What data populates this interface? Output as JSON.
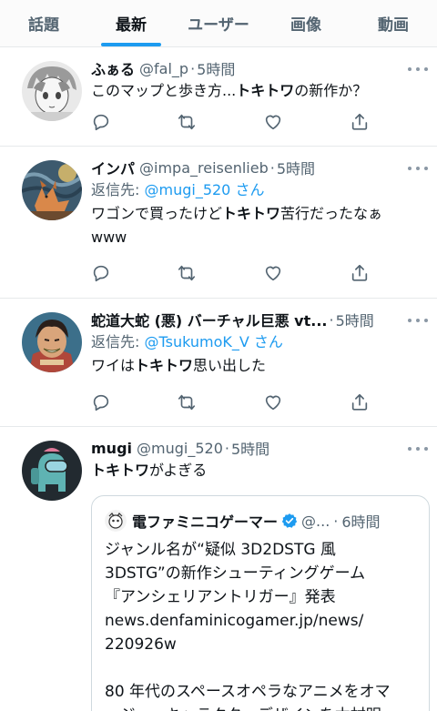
{
  "tabs": [
    "話題",
    "最新",
    "ユーザー",
    "画像",
    "動画"
  ],
  "tweets": [
    {
      "name": "ふぁる",
      "handle": "@fal_p",
      "dot": "·",
      "time": "5時間",
      "text_pre": "このマップと歩き方...",
      "text_bold": "トキトワ",
      "text_post": "の新作か？"
    },
    {
      "name": "インパ",
      "handle": "@impa_reisenlieb",
      "dot": "·",
      "time": "5時間",
      "reply_label": "返信先: ",
      "reply_mention": "@mugi_520 さん",
      "text_pre": "ワゴンで買ったけど",
      "text_bold": "トキトワ",
      "text_post": "苦行だったなぁ",
      "text_line2": "www"
    },
    {
      "name": "蛇道大蛇 (悪) バーチャル巨悪 vt...",
      "dot": "·",
      "time": "5時間",
      "reply_label": "返信先: ",
      "reply_mention": "@TsukumoK_V さん",
      "text_pre": "ワイは",
      "text_bold": "トキトワ",
      "text_post": "思い出した"
    },
    {
      "name": "mugi",
      "handle": "@mugi_520",
      "dot": "·",
      "time": "5時間",
      "text_bold": "トキトワ",
      "text_post": "がよぎる"
    }
  ],
  "quote": {
    "name": "電ファミニコゲーマー",
    "handle": "@...",
    "dot": "·",
    "time": "6時間",
    "lines": [
      "ジャンル名が“疑似 3D2DSTG 風",
      "3DSTG”の新作シューティングゲーム",
      "『アンシェリアントリガー』発表",
      "news.denfaminicogamer.jp/news/",
      "220926w",
      "",
      "80 年代のスペースオペラなアニメをオマ",
      "ージュ。キャラクターデザインを木村明"
    ]
  },
  "colors": {
    "accent": "#1d9bf0",
    "text": "#0f1419",
    "muted": "#536471",
    "border": "#e6e9eb"
  },
  "icons": [
    "reply-icon",
    "retweet-icon",
    "like-icon",
    "share-icon",
    "more-icon",
    "verified-badge-icon"
  ]
}
